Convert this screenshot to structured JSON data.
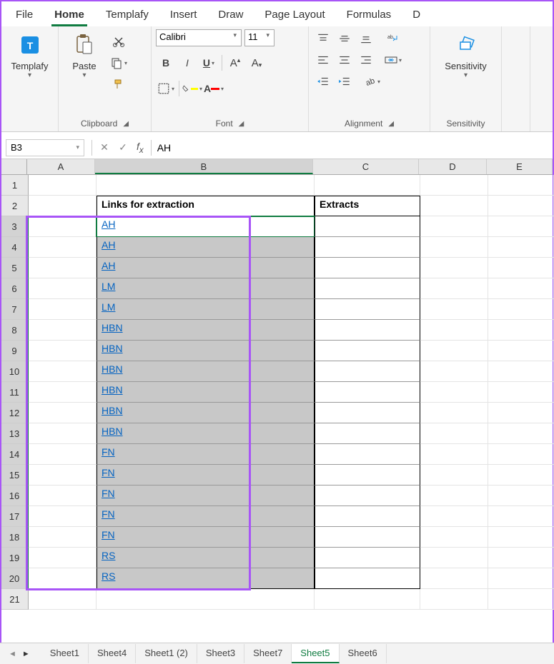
{
  "ribbon_tabs": [
    "File",
    "Home",
    "Templafy",
    "Insert",
    "Draw",
    "Page Layout",
    "Formulas",
    "D"
  ],
  "active_ribbon_tab": "Home",
  "ribbon": {
    "templafy": {
      "label": "Templafy"
    },
    "clipboard": {
      "group_label": "Clipboard",
      "paste_label": "Paste"
    },
    "font": {
      "group_label": "Font",
      "font_name": "Calibri",
      "font_size": "11",
      "bold": "B",
      "italic": "I",
      "underline": "U"
    },
    "alignment": {
      "group_label": "Alignment"
    },
    "sensitivity": {
      "group_label": "Sensitivity",
      "label": "Sensitivity"
    }
  },
  "namebox": "B3",
  "formula_value": "AH",
  "columns": [
    "A",
    "B",
    "C",
    "D",
    "E"
  ],
  "headers": {
    "B": "Links for extraction",
    "C": "Extracts"
  },
  "rows": [
    {
      "n": 1
    },
    {
      "n": 2,
      "is_header": true
    },
    {
      "n": 3,
      "link": "AH",
      "active": true
    },
    {
      "n": 4,
      "link": "AH"
    },
    {
      "n": 5,
      "link": "AH"
    },
    {
      "n": 6,
      "link": "LM"
    },
    {
      "n": 7,
      "link": "LM"
    },
    {
      "n": 8,
      "link": "HBN"
    },
    {
      "n": 9,
      "link": "HBN"
    },
    {
      "n": 10,
      "link": "HBN"
    },
    {
      "n": 11,
      "link": "HBN"
    },
    {
      "n": 12,
      "link": "HBN"
    },
    {
      "n": 13,
      "link": "HBN"
    },
    {
      "n": 14,
      "link": "FN"
    },
    {
      "n": 15,
      "link": "FN"
    },
    {
      "n": 16,
      "link": "FN"
    },
    {
      "n": 17,
      "link": "FN"
    },
    {
      "n": 18,
      "link": "FN"
    },
    {
      "n": 19,
      "link": "RS"
    },
    {
      "n": 20,
      "link": "RS"
    },
    {
      "n": 21
    }
  ],
  "sheet_tabs": [
    "Sheet1",
    "Sheet4",
    "Sheet1 (2)",
    "Sheet3",
    "Sheet7",
    "Sheet5",
    "Sheet6"
  ],
  "active_sheet": "Sheet5"
}
